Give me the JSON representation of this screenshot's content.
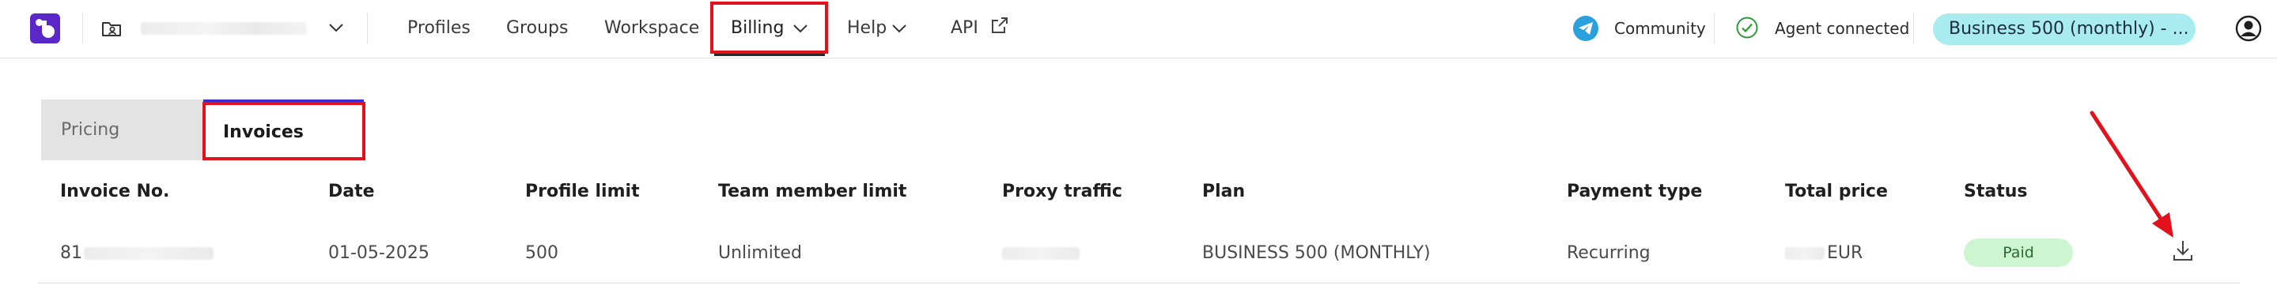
{
  "colors": {
    "brand": "#5b27c9",
    "highlight_annotation": "#e2111c",
    "plan_pill_bg": "#a8ecef",
    "status_paid_bg": "#cdf5cf",
    "active_tab_accent": "#3a2bd2"
  },
  "header": {
    "logo_icon": "brand-logo",
    "workspace_icon": "folder-user-icon",
    "account_email_masked": "",
    "nav": {
      "profiles": "Profiles",
      "groups": "Groups",
      "workspace": "Workspace",
      "billing": "Billing",
      "help": "Help",
      "api": "API"
    },
    "community_label": "Community",
    "agent_status_label": "Agent connected",
    "plan_label": "Business 500 (monthly) - ..."
  },
  "tabs": {
    "pricing": "Pricing",
    "invoices": "Invoices",
    "active": "Invoices"
  },
  "invoices_table": {
    "columns": [
      "Invoice No.",
      "Date",
      "Profile limit",
      "Team member limit",
      "Proxy traffic",
      "Plan",
      "Payment type",
      "Total price",
      "Status"
    ],
    "rows": [
      {
        "invoice_no_prefix": "81",
        "date": "01-05-2025",
        "profile_limit": "500",
        "team_member_limit": "Unlimited",
        "proxy_traffic": "",
        "plan": "BUSINESS 500 (MONTHLY)",
        "payment_type": "Recurring",
        "total_price_currency": "EUR",
        "status": "Paid",
        "action_icon": "download-icon"
      }
    ]
  }
}
